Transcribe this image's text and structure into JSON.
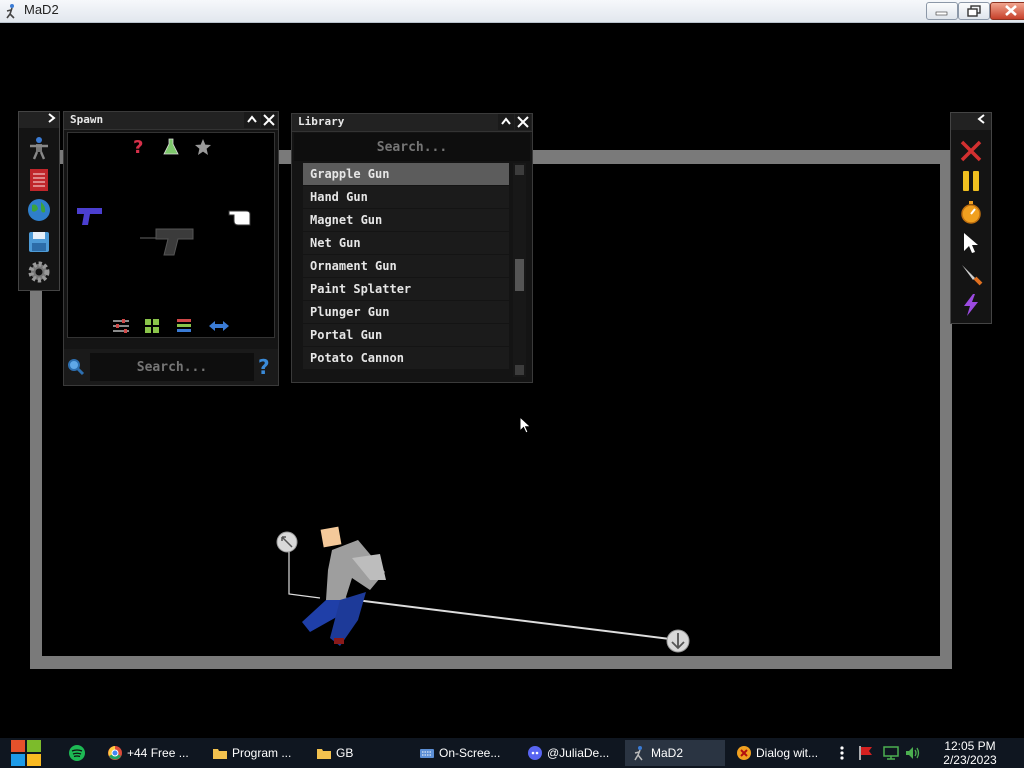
{
  "window": {
    "title": "MaD2"
  },
  "spawn_panel": {
    "title": "Spawn",
    "search_placeholder": "Search...",
    "icons": [
      "help-icon",
      "flask-icon",
      "star-icon",
      "blue-gun-icon",
      "pistol-icon",
      "pointer-hand-icon",
      "sliders-icon",
      "grid-icon",
      "list-icon",
      "swap-arrows-icon",
      "magnifier-icon",
      "question-icon"
    ]
  },
  "library_panel": {
    "title": "Library",
    "search_placeholder": "Search...",
    "items": [
      {
        "label": "Grapple Gun",
        "selected": true
      },
      {
        "label": "Hand Gun",
        "selected": false
      },
      {
        "label": "Magnet Gun",
        "selected": false
      },
      {
        "label": "Net Gun",
        "selected": false
      },
      {
        "label": "Ornament Gun",
        "selected": false
      },
      {
        "label": "Paint Splatter",
        "selected": false
      },
      {
        "label": "Plunger Gun",
        "selected": false
      },
      {
        "label": "Portal Gun",
        "selected": false
      },
      {
        "label": "Potato Cannon",
        "selected": false
      }
    ]
  },
  "left_toolbar": {
    "icons": [
      "ragdoll-icon",
      "book-icon",
      "globe-icon",
      "save-icon",
      "settings-gear-icon"
    ]
  },
  "right_toolbar": {
    "icons": [
      "clear-x-icon",
      "pause-icon",
      "stopwatch-icon",
      "cursor-icon",
      "knife-icon",
      "lightning-icon"
    ]
  },
  "taskbar": {
    "items": [
      {
        "label": "+44 Free ...",
        "icon": "chrome-icon",
        "active": false
      },
      {
        "label": "Program ...",
        "icon": "folder-icon",
        "active": false
      },
      {
        "label": "GB",
        "icon": "folder-icon",
        "active": false
      },
      {
        "label": "On-Scree...",
        "icon": "keyboard-icon",
        "active": false
      },
      {
        "label": "@JuliaDe...",
        "icon": "discord-icon",
        "active": false
      },
      {
        "label": "MaD2",
        "icon": "mad2-icon",
        "active": true
      },
      {
        "label": "Dialog wit...",
        "icon": "dialog-icon",
        "active": false
      }
    ],
    "clock": {
      "time": "12:05 PM",
      "date": "2/23/2023"
    }
  },
  "colors": {
    "arena_wall": "#7a7a7a",
    "selected_item": "#5c5c5c",
    "background": "#000000"
  }
}
